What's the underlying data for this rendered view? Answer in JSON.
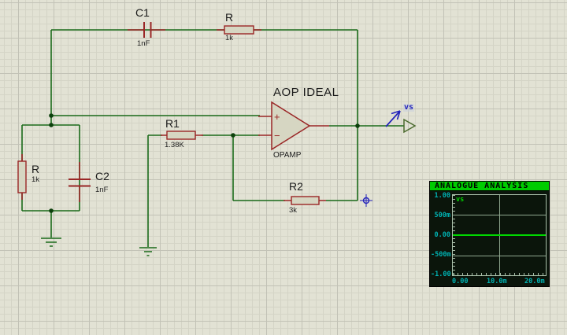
{
  "app": {
    "view": "schematic-capture"
  },
  "colors": {
    "wire": "#1a6a1a",
    "component": "#9a2626",
    "fill": "#d6d6c2",
    "probe_blue": "#2323bb",
    "graph_title_bg": "#00cc00",
    "graph_bg": "#0b150b",
    "graph_trace": "#00d800",
    "graph_label": "#00b2b2"
  },
  "components": {
    "c1": {
      "ref": "C1",
      "value": "1nF"
    },
    "r_top": {
      "ref": "R",
      "value": "1k"
    },
    "r_left": {
      "ref": "R",
      "value": "1k"
    },
    "c2": {
      "ref": "C2",
      "value": "1nF"
    },
    "r1": {
      "ref": "R1",
      "value": "1.38K"
    },
    "r2": {
      "ref": "R2",
      "value": "3k"
    },
    "opamp": {
      "ref": "AOP IDEAL",
      "model": "OPAMP",
      "plus": "+",
      "minus": "−"
    }
  },
  "probe": {
    "label": "vs"
  },
  "analysis": {
    "title": "ANALOGUE ANALYSIS",
    "trace_label": "vs",
    "y_labels": [
      "1.00",
      "500m",
      "0.00",
      "-500m",
      "-1.00"
    ],
    "x_labels": [
      "0.00",
      "10.0m",
      "20.0m"
    ],
    "chart_data": {
      "type": "line",
      "title": "ANALOGUE ANALYSIS",
      "series": [
        {
          "name": "vs",
          "x": [
            "0.00",
            "20.0m"
          ],
          "y": [
            0,
            0
          ]
        }
      ],
      "ylim": [
        -1.0,
        1.0
      ],
      "xlim": [
        "0.00",
        "20.0m"
      ],
      "grid": true,
      "legend_position": "top-left"
    }
  }
}
